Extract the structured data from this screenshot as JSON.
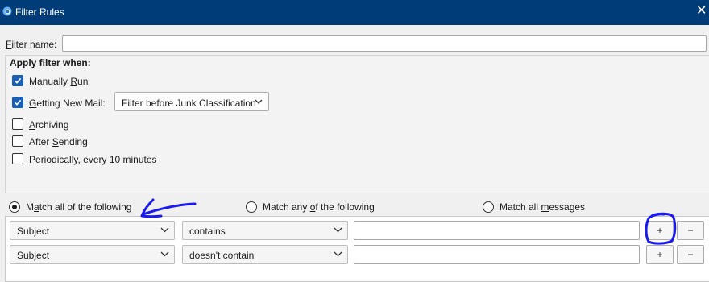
{
  "window": {
    "title": "Filter Rules",
    "close_glyph": "✕",
    "accent": "#003c78"
  },
  "filter_name": {
    "label_prefix": "F",
    "label_rest": "ilter name:",
    "value": ""
  },
  "apply": {
    "heading": "Apply filter when:",
    "manual": {
      "pre": "Manually ",
      "u": "R",
      "post": "un",
      "checked": true
    },
    "newmail": {
      "pre": "",
      "u": "G",
      "post": "etting New Mail:",
      "checked": true,
      "option": "Filter before Junk Classification"
    },
    "archiving": {
      "pre": "",
      "u": "A",
      "post": "rchiving",
      "checked": false
    },
    "sending": {
      "pre": "After ",
      "u": "S",
      "post": "ending",
      "checked": false
    },
    "periodic": {
      "pre": "",
      "u": "P",
      "post": "eriodically, every 10 minutes",
      "checked": false
    }
  },
  "match": {
    "all": {
      "pre": "M",
      "u": "a",
      "post": "tch all of the following",
      "selected": true
    },
    "any": {
      "pre": "Match any ",
      "u": "o",
      "post": "f the following",
      "selected": false
    },
    "messages": {
      "pre": "Match all ",
      "u": "m",
      "post": "essages",
      "selected": false
    }
  },
  "rules": [
    {
      "field": "Subject",
      "operator": "contains",
      "value": ""
    },
    {
      "field": "Subject",
      "operator": "doesn't contain",
      "value": ""
    }
  ],
  "buttons": {
    "add": "+",
    "remove": "−"
  },
  "annotations": {
    "color": "#1a1af0",
    "items": [
      "arrow-pointing-left",
      "circle-around-add-button"
    ]
  }
}
